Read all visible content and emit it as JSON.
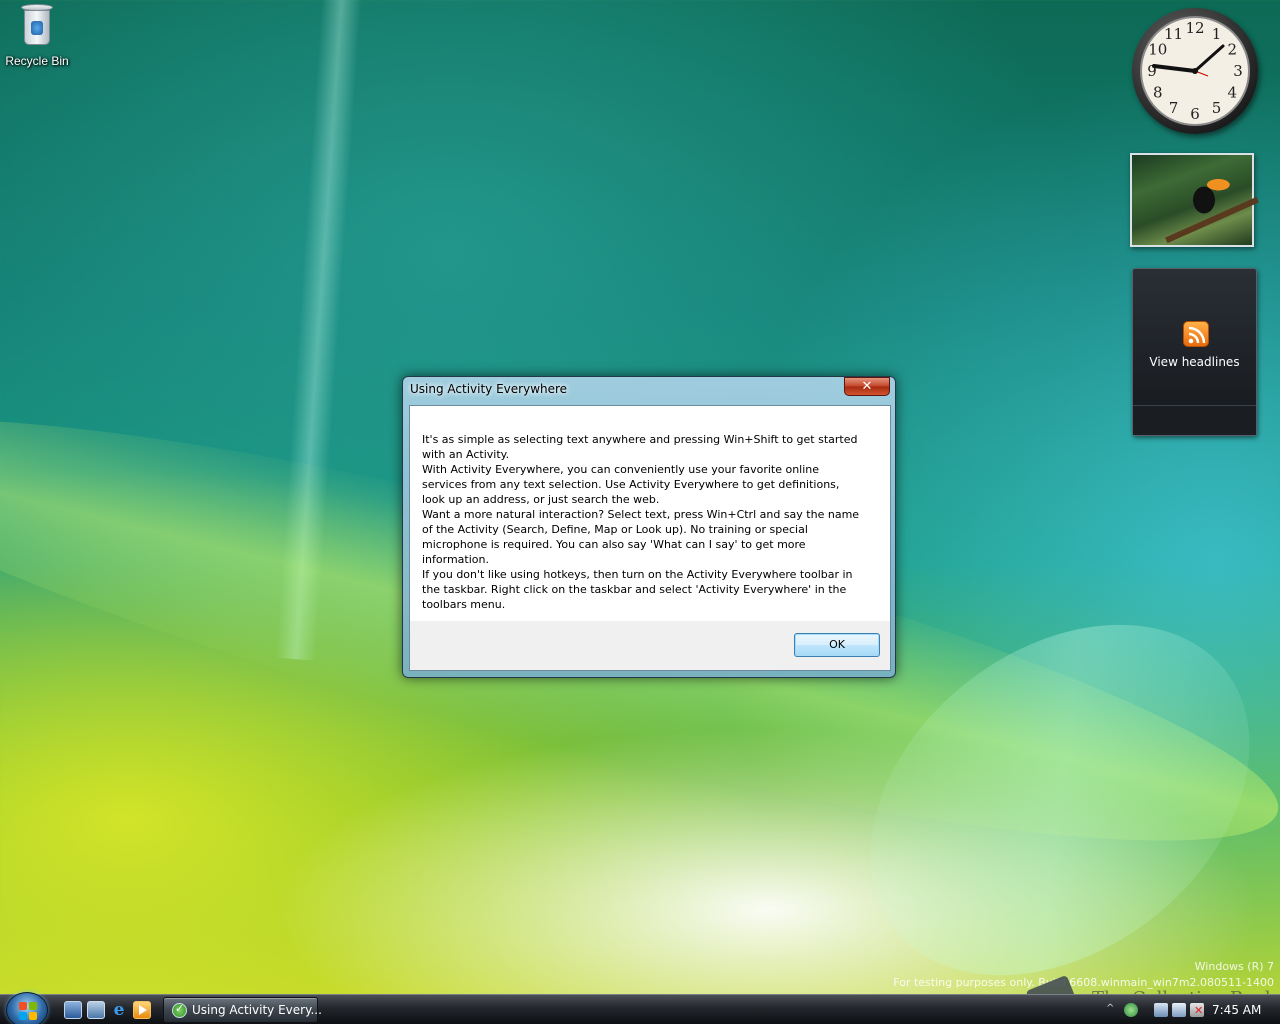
{
  "desktop": {
    "icons": [
      {
        "label": "Recycle Bin",
        "icon": "recycle-bin-icon"
      }
    ]
  },
  "gadgets": {
    "clock": {
      "icon": "analog-clock",
      "numerals": [
        "12",
        "1",
        "2",
        "3",
        "4",
        "5",
        "6",
        "7",
        "8",
        "9",
        "10",
        "11"
      ]
    },
    "slideshow": {
      "icon": "toucan-photo"
    },
    "feed": {
      "label": "View headlines",
      "icon": "rss-icon"
    }
  },
  "dialog": {
    "title": "Using Activity Everywhere",
    "close_label": "✕",
    "paragraphs": [
      "It's as simple as selecting text anywhere and pressing Win+Shift to get started with an Activity.",
      "With Activity Everywhere, you can conveniently use your favorite online services from any text selection. Use Activity Everywhere to get definitions, look up an address, or just search the web.",
      "Want a more natural interaction? Select text, press Win+Ctrl and say the name of the Activity (Search, Define, Map or Look up).  No training or special microphone is required. You can also say 'What can I say' to get more information.",
      "If you don't like using hotkeys, then turn on the Activity Everywhere toolbar in the taskbar. Right click on the taskbar and select 'Activity Everywhere' in the toolbars menu."
    ],
    "ok_label": "OK"
  },
  "watermark": {
    "line1": "Windows (R) 7",
    "line2": "For testing purposes only. Build 6608.winmain_win7m2.080511-1400",
    "brand": "The Collection Book"
  },
  "taskbar": {
    "start_icon": "windows-start-orb",
    "quick_launch": [
      "show-desktop-icon",
      "switch-windows-icon",
      "internet-explorer-icon",
      "media-player-icon"
    ],
    "tasks": [
      {
        "label": "Using Activity Every...",
        "icon": "activity-check-icon"
      }
    ],
    "tray": {
      "chevron": "^",
      "clock": "7:45 AM"
    }
  },
  "colors": {
    "taskbar_top": "#4a4f55",
    "dialog_frame": "#aad2e6",
    "close_red": "#c34327",
    "ok_blue": "#3c7fb1"
  }
}
